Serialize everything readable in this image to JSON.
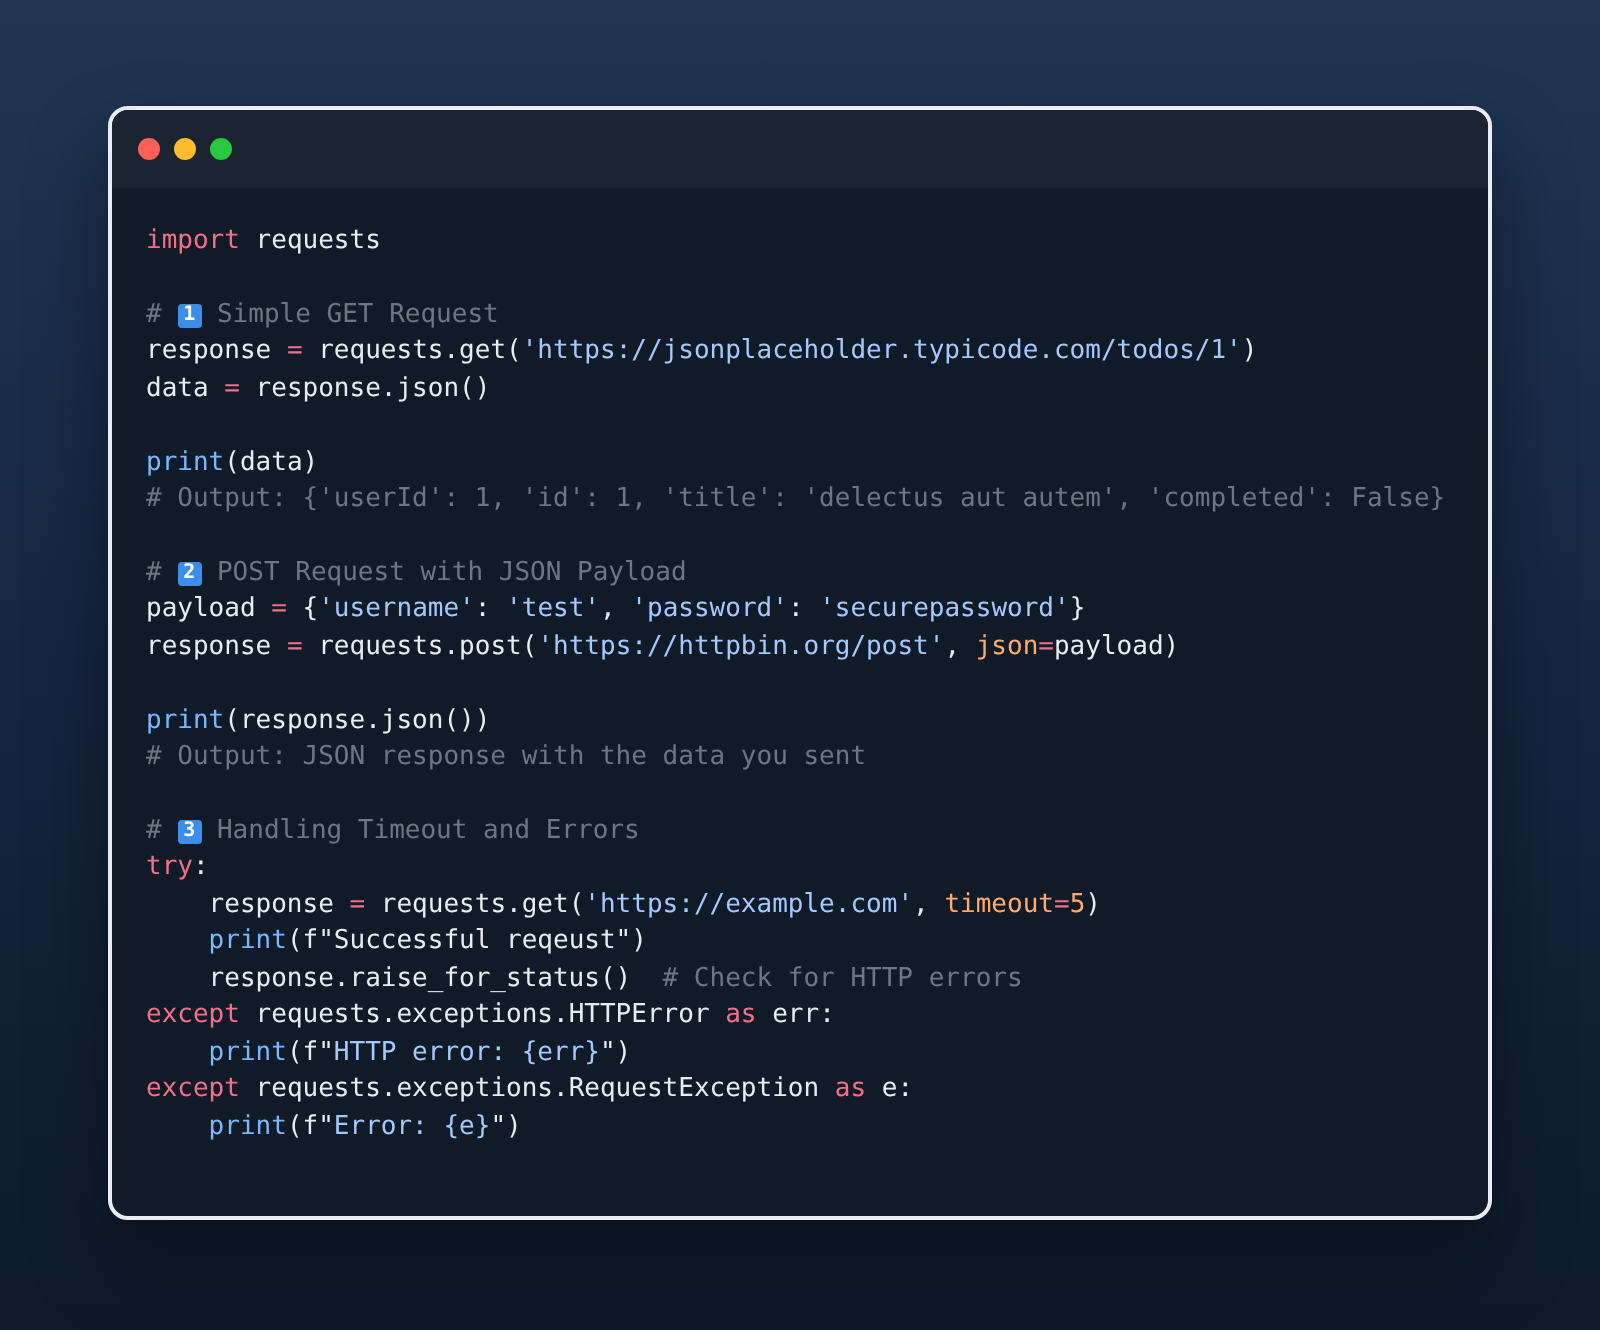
{
  "window": {
    "buttons": [
      {
        "kind": "close"
      },
      {
        "kind": "minimize"
      },
      {
        "kind": "maximize"
      }
    ]
  },
  "code": [
    {
      "kind": "code",
      "tokens": [
        {
          "kind": "keyword",
          "text": "import"
        },
        {
          "kind": "plain",
          "text": " requests"
        }
      ]
    },
    {
      "kind": "blank"
    },
    {
      "kind": "code",
      "tokens": [
        {
          "kind": "comment",
          "text": "# "
        },
        {
          "kind": "badge",
          "text": "1"
        },
        {
          "kind": "comment",
          "text": " Simple GET Request"
        }
      ]
    },
    {
      "kind": "code",
      "tokens": [
        {
          "kind": "plain",
          "text": "response "
        },
        {
          "kind": "operator",
          "text": "="
        },
        {
          "kind": "plain",
          "text": " requests.get("
        },
        {
          "kind": "string",
          "text": "'https://jsonplaceholder.typicode.com/todos/1'"
        },
        {
          "kind": "plain",
          "text": ")"
        }
      ]
    },
    {
      "kind": "code",
      "tokens": [
        {
          "kind": "plain",
          "text": "data "
        },
        {
          "kind": "operator",
          "text": "="
        },
        {
          "kind": "plain",
          "text": " response.json()"
        }
      ]
    },
    {
      "kind": "blank"
    },
    {
      "kind": "code",
      "tokens": [
        {
          "kind": "function",
          "text": "print"
        },
        {
          "kind": "plain",
          "text": "(data)"
        }
      ]
    },
    {
      "kind": "code",
      "tokens": [
        {
          "kind": "comment",
          "text": "# Output: {'userId': 1, 'id': 1, 'title': 'delectus aut autem', 'completed': False}"
        }
      ]
    },
    {
      "kind": "blank"
    },
    {
      "kind": "code",
      "tokens": [
        {
          "kind": "comment",
          "text": "# "
        },
        {
          "kind": "badge",
          "text": "2"
        },
        {
          "kind": "comment",
          "text": " POST Request with JSON Payload"
        }
      ]
    },
    {
      "kind": "code",
      "tokens": [
        {
          "kind": "plain",
          "text": "payload "
        },
        {
          "kind": "operator",
          "text": "="
        },
        {
          "kind": "plain",
          "text": " {"
        },
        {
          "kind": "string",
          "text": "'username'"
        },
        {
          "kind": "plain",
          "text": ": "
        },
        {
          "kind": "string",
          "text": "'test'"
        },
        {
          "kind": "plain",
          "text": ", "
        },
        {
          "kind": "string",
          "text": "'password'"
        },
        {
          "kind": "plain",
          "text": ": "
        },
        {
          "kind": "string",
          "text": "'securepassword'"
        },
        {
          "kind": "plain",
          "text": "}"
        }
      ]
    },
    {
      "kind": "code",
      "tokens": [
        {
          "kind": "plain",
          "text": "response "
        },
        {
          "kind": "operator",
          "text": "="
        },
        {
          "kind": "plain",
          "text": " requests.post("
        },
        {
          "kind": "string",
          "text": "'https://httpbin.org/post'"
        },
        {
          "kind": "plain",
          "text": ", "
        },
        {
          "kind": "param",
          "text": "json"
        },
        {
          "kind": "operator",
          "text": "="
        },
        {
          "kind": "plain",
          "text": "payload)"
        }
      ]
    },
    {
      "kind": "blank"
    },
    {
      "kind": "code",
      "tokens": [
        {
          "kind": "function",
          "text": "print"
        },
        {
          "kind": "plain",
          "text": "(response.json())"
        }
      ]
    },
    {
      "kind": "code",
      "tokens": [
        {
          "kind": "comment",
          "text": "# Output: JSON response with the data you sent"
        }
      ]
    },
    {
      "kind": "blank"
    },
    {
      "kind": "code",
      "tokens": [
        {
          "kind": "comment",
          "text": "# "
        },
        {
          "kind": "badge",
          "text": "3"
        },
        {
          "kind": "comment",
          "text": " Handling Timeout and Errors"
        }
      ]
    },
    {
      "kind": "code",
      "tokens": [
        {
          "kind": "keyword",
          "text": "try"
        },
        {
          "kind": "plain",
          "text": ":"
        }
      ]
    },
    {
      "kind": "code",
      "indented": true,
      "tokens": [
        {
          "kind": "plain",
          "text": "response "
        },
        {
          "kind": "operator",
          "text": "="
        },
        {
          "kind": "plain",
          "text": " requests.get("
        },
        {
          "kind": "string",
          "text": "'https://example.com'"
        },
        {
          "kind": "plain",
          "text": ", "
        },
        {
          "kind": "param",
          "text": "timeout"
        },
        {
          "kind": "operator",
          "text": "="
        },
        {
          "kind": "param",
          "text": "5"
        },
        {
          "kind": "plain",
          "text": ")"
        }
      ]
    },
    {
      "kind": "code",
      "indented": true,
      "tokens": [
        {
          "kind": "function",
          "text": "print"
        },
        {
          "kind": "plain",
          "text": "(f\"Successful reqeust\")"
        }
      ]
    },
    {
      "kind": "code",
      "indented": true,
      "tokens": [
        {
          "kind": "plain",
          "text": "response.raise_for_status()  "
        },
        {
          "kind": "comment",
          "text": "# Check for HTTP errors"
        }
      ]
    },
    {
      "kind": "code",
      "tokens": [
        {
          "kind": "keyword",
          "text": "except"
        },
        {
          "kind": "plain",
          "text": " requests.exceptions.HTTPError "
        },
        {
          "kind": "keyword",
          "text": "as"
        },
        {
          "kind": "plain",
          "text": " err:"
        }
      ]
    },
    {
      "kind": "code",
      "indented": true,
      "tokens": [
        {
          "kind": "function",
          "text": "print"
        },
        {
          "kind": "plain",
          "text": "(f\""
        },
        {
          "kind": "fstring",
          "text": "HTTP error: {err}"
        },
        {
          "kind": "plain",
          "text": "\")"
        }
      ]
    },
    {
      "kind": "code",
      "tokens": [
        {
          "kind": "keyword",
          "text": "except"
        },
        {
          "kind": "plain",
          "text": " requests.exceptions.RequestException "
        },
        {
          "kind": "keyword",
          "text": "as"
        },
        {
          "kind": "plain",
          "text": " e:"
        }
      ]
    },
    {
      "kind": "code",
      "indented": true,
      "tokens": [
        {
          "kind": "function",
          "text": "print"
        },
        {
          "kind": "plain",
          "text": "(f\""
        },
        {
          "kind": "fstring",
          "text": "Error: {e}"
        },
        {
          "kind": "plain",
          "text": "\")"
        }
      ]
    }
  ]
}
